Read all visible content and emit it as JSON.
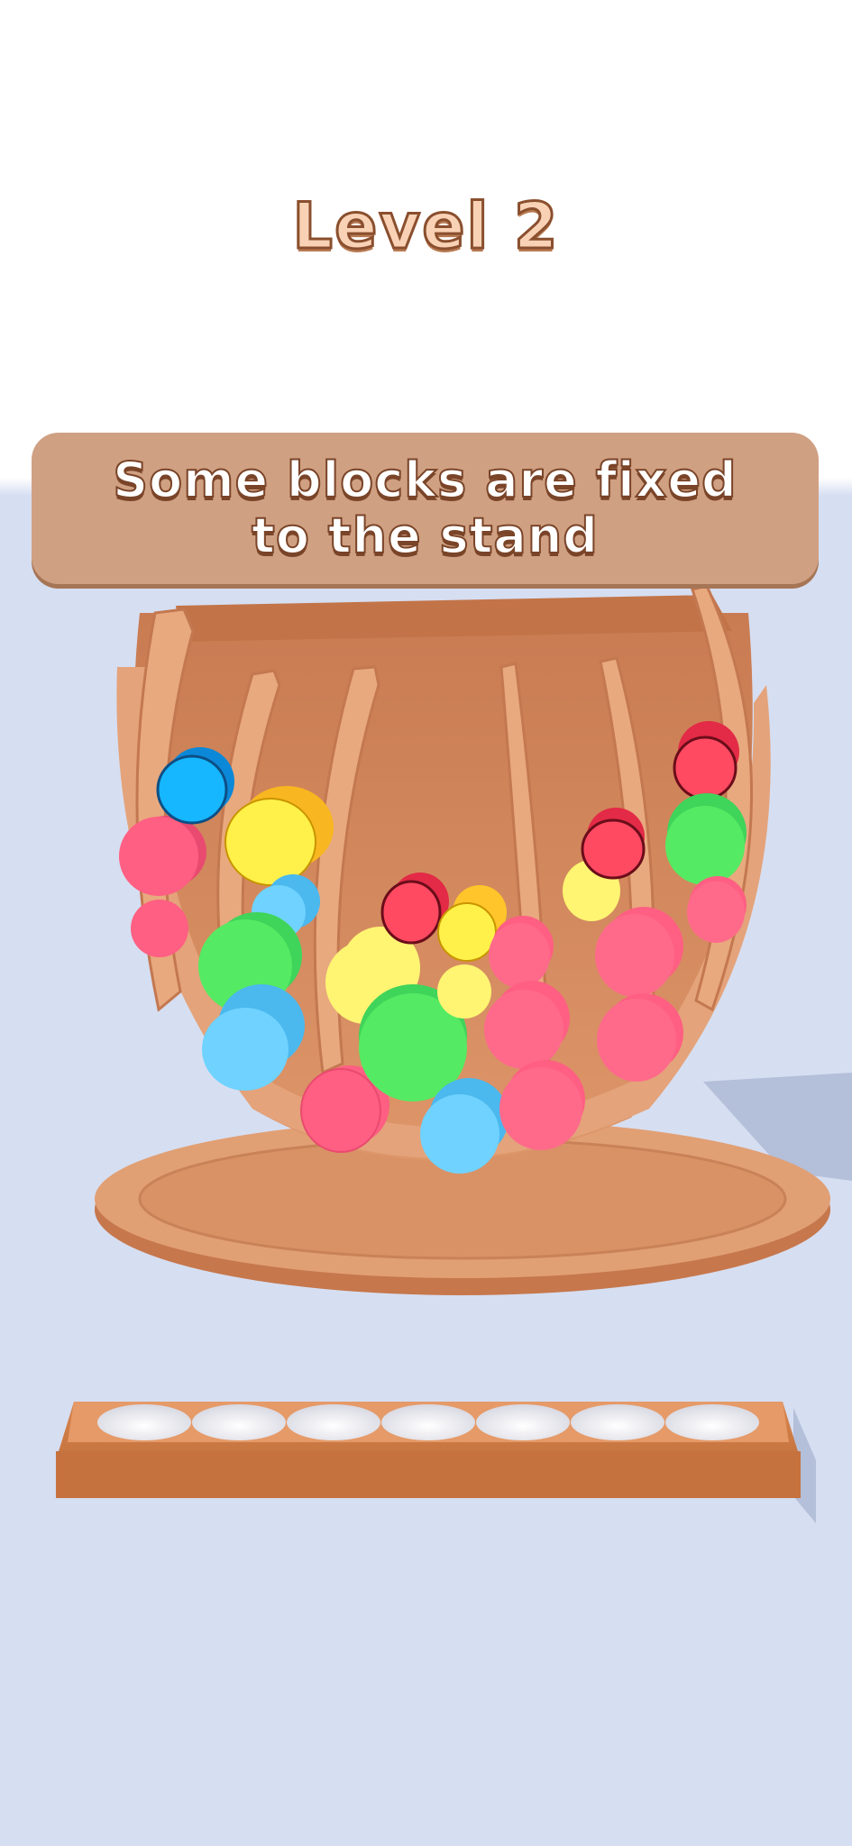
{
  "level": {
    "title": "Level 2"
  },
  "hint": {
    "text": "Some blocks are fixed\nto the stand"
  },
  "tray": {
    "slot_count": 7,
    "filled_slots": 0
  },
  "palette": {
    "background_top": "#ffffff",
    "floor": "#d6def1",
    "wood_light": "#e9a57c",
    "wood_dark": "#c47850",
    "block_red": "#ff4a62",
    "block_pink": "#ff5f82",
    "block_blue": "#6fd2ff",
    "block_yellow": "#fff14a",
    "block_green": "#55ea63"
  }
}
